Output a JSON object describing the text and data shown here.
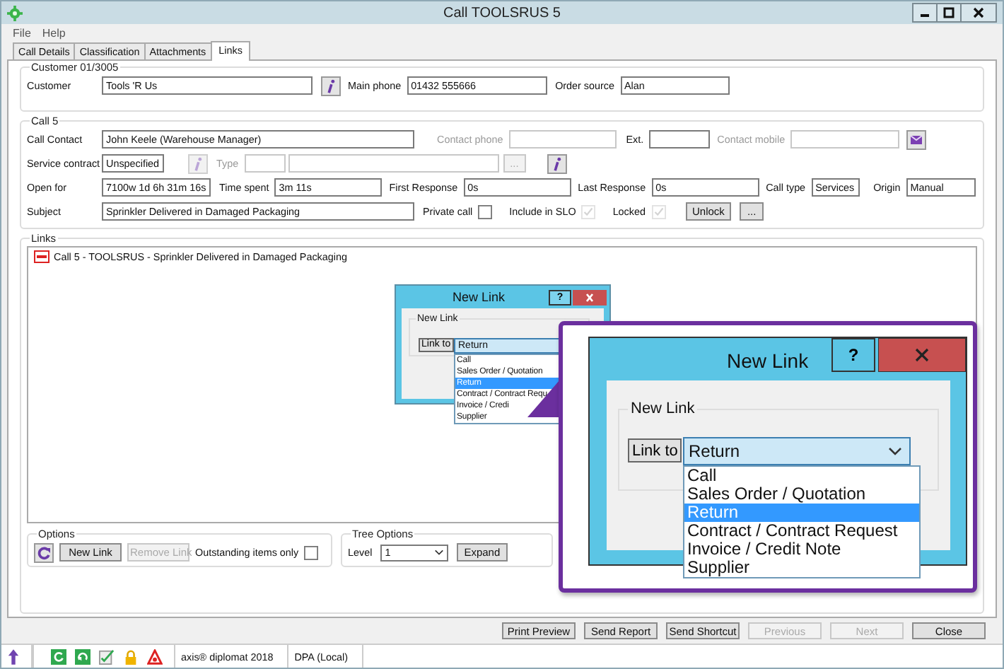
{
  "window": {
    "title": "Call TOOLSRUS 5"
  },
  "menu": [
    "File",
    "Help"
  ],
  "tabs": [
    {
      "label": "Call Details",
      "selected": false
    },
    {
      "label": "Classification",
      "selected": false
    },
    {
      "label": "Attachments",
      "selected": false
    },
    {
      "label": "Links",
      "selected": true
    }
  ],
  "customer": {
    "title": "Customer 01/3005",
    "items": [
      {
        "kind": "field",
        "label": "Customer",
        "value": "Tools 'R Us",
        "disabled": false
      },
      {
        "kind": "info",
        "disabled": false
      },
      {
        "kind": "field",
        "label": "Main phone",
        "value": "01432 555666",
        "disabled": false
      },
      {
        "kind": "field",
        "label": "Order source",
        "value": "Alan",
        "disabled": false
      }
    ]
  },
  "call": {
    "title": "Call 5",
    "rows": [
      {
        "items": [
          {
            "kind": "field",
            "label": "Call Contact",
            "value": "John Keele (Warehouse Manager)",
            "disabled": false
          },
          {
            "kind": "field",
            "label": "Contact phone",
            "disabled": true
          },
          {
            "kind": "field",
            "label": "Ext.",
            "disabled": false
          },
          {
            "kind": "field",
            "label": "Contact mobile",
            "disabled": true
          },
          {
            "kind": "mail",
            "disabled": false
          }
        ]
      },
      {
        "items": [
          {
            "kind": "field",
            "label": "Service contract",
            "value": "Unspecified",
            "disabled": false
          },
          {
            "kind": "info",
            "disabled": true
          },
          {
            "kind": "field",
            "label": "Type",
            "disabled": true
          },
          {
            "kind": "field",
            "disabled": true
          },
          {
            "kind": "button",
            "label": "...",
            "disabled": true
          },
          {
            "kind": "info",
            "disabled": false
          }
        ]
      },
      {
        "items": [
          {
            "kind": "field",
            "label": "Open for",
            "value": "7100w 1d 6h 31m 16s",
            "disabled": false
          },
          {
            "kind": "field",
            "label": "Time spent",
            "value": "3m 11s",
            "disabled": false
          },
          {
            "kind": "field",
            "label": "First Response",
            "value": "0s",
            "disabled": false
          },
          {
            "kind": "field",
            "label": "Last Response",
            "value": "0s",
            "disabled": false
          },
          {
            "kind": "field",
            "label": "Call type",
            "value": "Services",
            "disabled": false
          },
          {
            "kind": "field",
            "label": "Origin",
            "value": "Manual",
            "disabled": false
          }
        ]
      },
      {
        "items": [
          {
            "kind": "field",
            "label": "Subject",
            "value": "Sprinkler Delivered in Damaged Packaging",
            "disabled": false
          },
          {
            "kind": "check",
            "label": "Private call",
            "checked": false,
            "disabled": false
          },
          {
            "kind": "check",
            "label": "Include in SLO",
            "checked": true,
            "disabled": true
          },
          {
            "kind": "check",
            "label": "Locked",
            "checked": true,
            "disabled": true
          },
          {
            "kind": "button",
            "label": "Unlock",
            "disabled": false
          },
          {
            "kind": "button",
            "label": "...",
            "disabled": false
          }
        ]
      }
    ]
  },
  "links": {
    "title": "Links",
    "tree": [
      {
        "label": "Call 5 - TOOLSRUS - Sprinkler Delivered in Damaged Packaging"
      }
    ]
  },
  "options": {
    "title": "Options",
    "items": [
      {
        "kind": "refresh",
        "disabled": false
      },
      {
        "kind": "button",
        "label": "New Link",
        "disabled": false
      },
      {
        "kind": "button",
        "label": "Remove Link",
        "disabled": true
      },
      {
        "kind": "check",
        "label": "Outstanding items only",
        "checked": false,
        "disabled": false
      }
    ]
  },
  "tree_options": {
    "title": "Tree Options",
    "level_label": "Level",
    "level": "1",
    "expand": "Expand"
  },
  "buttons": [
    {
      "label": "Print Preview",
      "disabled": false
    },
    {
      "label": "Send Report",
      "disabled": false
    },
    {
      "label": "Send Shortcut",
      "disabled": false
    },
    {
      "label": "Previous",
      "disabled": true
    },
    {
      "label": "Next",
      "disabled": true
    },
    {
      "label": "Close",
      "disabled": false
    }
  ],
  "status_bar": {
    "product": "axis® diplomat 2018",
    "database": "DPA (Local)"
  },
  "new_link_dialog": {
    "title": "New Link",
    "help": "?",
    "group": "New Link",
    "link_to": "Link to",
    "value": "Return",
    "options": [
      {
        "label": "Call",
        "selected": false
      },
      {
        "label": "Sales Order / Quotation",
        "selected": false
      },
      {
        "label": "Return",
        "selected": true
      },
      {
        "label": "Contract / Contract Requ",
        "selected": false
      },
      {
        "label": "Invoice / Credi",
        "selected": false
      },
      {
        "label": "Supplier",
        "selected": false
      }
    ]
  },
  "callout": {
    "title": "New Link",
    "help": "?",
    "group": "New Link",
    "link_to": "Link to",
    "value": "Return",
    "options": [
      {
        "label": "Call",
        "selected": false
      },
      {
        "label": "Sales Order / Quotation",
        "selected": false
      },
      {
        "label": "Return",
        "selected": true
      },
      {
        "label": "Contract / Contract Request",
        "selected": false
      },
      {
        "label": "Invoice / Credit Note",
        "selected": false
      },
      {
        "label": "Supplier",
        "selected": false
      }
    ]
  }
}
